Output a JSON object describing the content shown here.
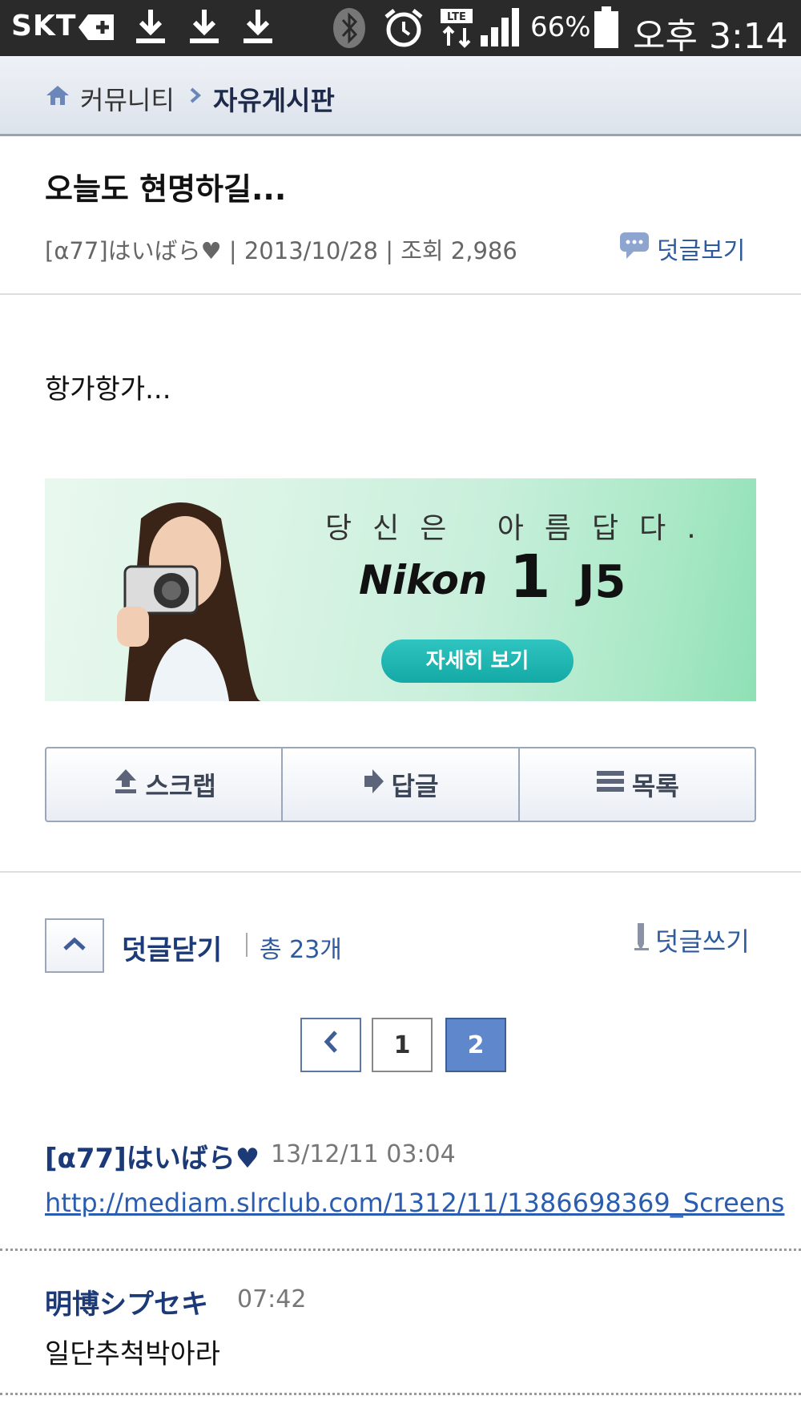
{
  "status_bar": {
    "carrier": "SKT",
    "battery_percent": "66%",
    "time": "오후 3:14",
    "icons": [
      "medical-plus-icon",
      "download-icon",
      "download-icon",
      "download-icon",
      "bluetooth-icon",
      "alarm-icon",
      "lte-icon",
      "signal-icon",
      "battery-icon"
    ]
  },
  "breadcrumb": {
    "home": "커뮤니티",
    "current": "자유게시판"
  },
  "post": {
    "title": "오늘도 현명하길...",
    "meta": "[α77]はいばら♥ | 2013/10/28 | 조회 2,986",
    "view_comments": "덧글보기",
    "body": "항가항가..."
  },
  "banner": {
    "slogan": "당신은 아름답다.",
    "brand": "Nikon",
    "model_number": "1",
    "model_name": "J5",
    "button": "자세히 보기",
    "colors": {
      "background": "#c8efdb",
      "button": "#14a9a6"
    }
  },
  "actions": {
    "scrap": "스크랩",
    "reply": "답글",
    "list": "목록"
  },
  "comments": {
    "close_label": "덧글닫기",
    "total": "총 23개",
    "write_label": "덧글쓰기",
    "pagination": {
      "pages": [
        "1",
        "2"
      ],
      "current": "2"
    },
    "items": [
      {
        "author": "[α77]はいばら♥",
        "time": "13/12/11 03:04",
        "text": "http://mediam.slrclub.com/1312/11/1386698369_Screens"
      },
      {
        "author": "明博シプセキ",
        "time": "07:42",
        "text": "일단추척박아라"
      }
    ]
  },
  "colors": {
    "accent": "#1d3a78",
    "link": "#2a5db0",
    "active_page": "#5f87cc"
  }
}
